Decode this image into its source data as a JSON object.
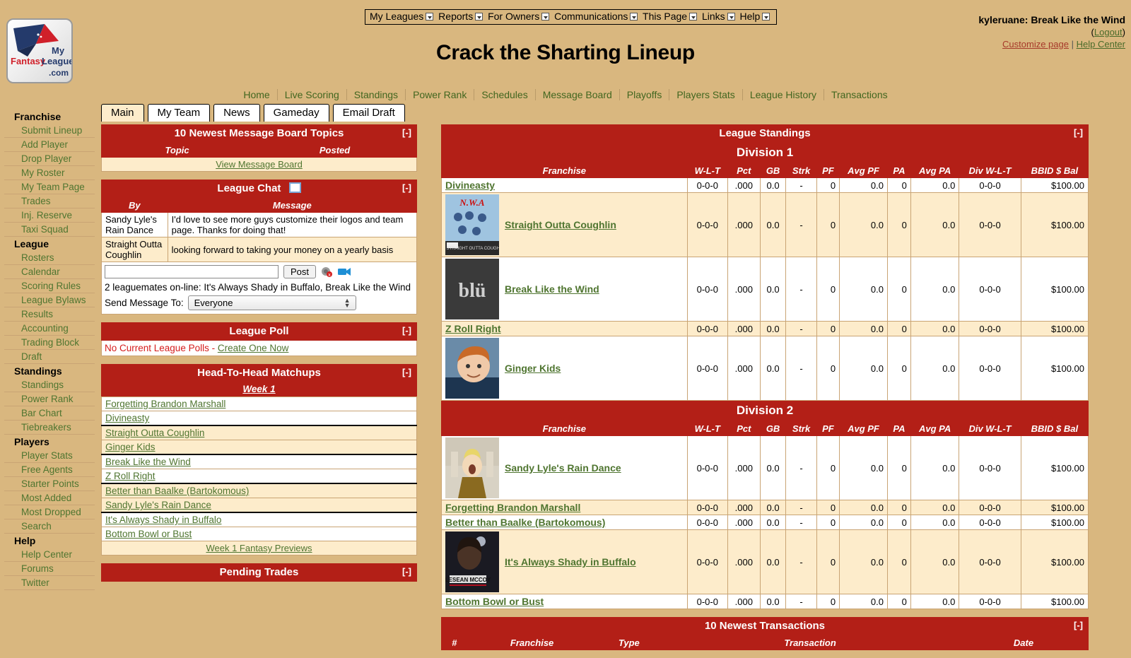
{
  "topmenu": {
    "items": [
      "My Leagues",
      "Reports",
      "For Owners",
      "Communications",
      "This Page",
      "Links",
      "Help"
    ]
  },
  "user": {
    "name": "kyleruane: Break Like the Wind",
    "logout": "Logout",
    "customize": "Customize page",
    "help_center": "Help Center",
    "separator": "|",
    "open_paren": "(",
    "close_paren": ")"
  },
  "page": {
    "title": "Crack the Sharting Lineup"
  },
  "logo": {
    "my": "My",
    "fantasy": "Fantasy",
    "league": "League",
    "com": ".com"
  },
  "mainnav": {
    "items": [
      "Home",
      "Live Scoring",
      "Standings",
      "Power Rank",
      "Schedules",
      "Message Board",
      "Playoffs",
      "Players Stats",
      "League History",
      "Transactions"
    ]
  },
  "tabs": [
    {
      "label": "Main",
      "active": true
    },
    {
      "label": "My Team",
      "active": false
    },
    {
      "label": "News",
      "active": false
    },
    {
      "label": "Gameday",
      "active": false
    },
    {
      "label": "Email Draft",
      "active": false
    }
  ],
  "sidebar": {
    "sections": [
      {
        "heading": "Franchise",
        "items": [
          "Submit Lineup",
          "Add Player",
          "Drop Player",
          "My Roster",
          "My Team Page",
          "Trades",
          "Inj. Reserve",
          "Taxi Squad"
        ]
      },
      {
        "heading": "League",
        "items": [
          "Rosters",
          "Calendar",
          "Scoring Rules",
          "League Bylaws",
          "Results",
          "Accounting",
          "Trading Block",
          "Draft"
        ]
      },
      {
        "heading": "Standings",
        "items": [
          "Standings",
          "Power Rank",
          "Bar Chart",
          "Tiebreakers"
        ]
      },
      {
        "heading": "Players",
        "items": [
          "Player Stats",
          "Free Agents",
          "Starter Points",
          "Most Added",
          "Most Dropped",
          "Search"
        ]
      },
      {
        "heading": "Help",
        "items": [
          "Help Center",
          "Forums",
          "Twitter"
        ]
      }
    ]
  },
  "message_board": {
    "title": "10 Newest Message Board Topics",
    "collapse": "[-]",
    "columns": [
      "Topic",
      "Posted"
    ],
    "view_link": "View Message Board"
  },
  "league_chat": {
    "title": "League Chat",
    "collapse": "[-]",
    "columns": [
      "By",
      "Message"
    ],
    "messages": [
      {
        "by": "Sandy Lyle's Rain Dance",
        "message": "I'd love to see more guys customize their logos and team page. Thanks for doing that!"
      },
      {
        "by": "Straight Outta Coughlin",
        "message": "looking forward to taking your money on a yearly basis"
      }
    ],
    "input_value": "",
    "input_placeholder": "",
    "post_label": "Post",
    "online_note": "2 leaguemates on-line: It's Always Shady in Buffalo, Break Like the Wind",
    "send_to_label": "Send Message To:",
    "send_to_value": "Everyone"
  },
  "league_poll": {
    "title": "League Poll",
    "collapse": "[-]",
    "no_polls_text": "No Current League Polls - ",
    "create_link": "Create One Now"
  },
  "h2h": {
    "title": "Head-To-Head Matchups",
    "collapse": "[-]",
    "week_label": "Week 1",
    "matchups": [
      [
        "Forgetting Brandon Marshall",
        "Divineasty"
      ],
      [
        "Straight Outta Coughlin",
        "Ginger Kids"
      ],
      [
        "Break Like the Wind",
        "Z Roll Right"
      ],
      [
        "Better than Baalke (Bartokomous)",
        "Sandy Lyle's Rain Dance"
      ],
      [
        "It's Always Shady in Buffalo",
        "Bottom Bowl or Bust"
      ]
    ],
    "previews_link": "Week 1 Fantasy Previews"
  },
  "pending_trades": {
    "title": "Pending Trades",
    "collapse": "[-]"
  },
  "standings": {
    "title": "League Standings",
    "collapse": "[-]",
    "columns": [
      "Franchise",
      "W-L-T",
      "Pct",
      "GB",
      "Strk",
      "PF",
      "Avg PF",
      "PA",
      "Avg PA",
      "Div W-L-T",
      "BBID $ Bal"
    ],
    "divisions": [
      {
        "name": "Division 1",
        "rows": [
          {
            "franchise": "Divineasty",
            "has_logo": false,
            "logo": "",
            "wlt": "0-0-0",
            "pct": ".000",
            "gb": "0.0",
            "strk": "-",
            "pf": "0",
            "avgpf": "0.0",
            "pa": "0",
            "avgpa": "0.0",
            "divwlt": "0-0-0",
            "bbid": "$100.00"
          },
          {
            "franchise": "Straight Outta Coughlin",
            "has_logo": true,
            "logo": "nwa",
            "wlt": "0-0-0",
            "pct": ".000",
            "gb": "0.0",
            "strk": "-",
            "pf": "0",
            "avgpf": "0.0",
            "pa": "0",
            "avgpa": "0.0",
            "divwlt": "0-0-0",
            "bbid": "$100.00"
          },
          {
            "franchise": "Break Like the Wind",
            "has_logo": true,
            "logo": "blu",
            "wlt": "0-0-0",
            "pct": ".000",
            "gb": "0.0",
            "strk": "-",
            "pf": "0",
            "avgpf": "0.0",
            "pa": "0",
            "avgpa": "0.0",
            "divwlt": "0-0-0",
            "bbid": "$100.00"
          },
          {
            "franchise": "Z Roll Right",
            "has_logo": false,
            "logo": "",
            "wlt": "0-0-0",
            "pct": ".000",
            "gb": "0.0",
            "strk": "-",
            "pf": "0",
            "avgpf": "0.0",
            "pa": "0",
            "avgpa": "0.0",
            "divwlt": "0-0-0",
            "bbid": "$100.00"
          },
          {
            "franchise": "Ginger Kids",
            "has_logo": true,
            "logo": "ginger",
            "wlt": "0-0-0",
            "pct": ".000",
            "gb": "0.0",
            "strk": "-",
            "pf": "0",
            "avgpf": "0.0",
            "pa": "0",
            "avgpa": "0.0",
            "divwlt": "0-0-0",
            "bbid": "$100.00"
          }
        ]
      },
      {
        "name": "Division 2",
        "rows": [
          {
            "franchise": "Sandy Lyle's Rain Dance",
            "has_logo": true,
            "logo": "sandy",
            "wlt": "0-0-0",
            "pct": ".000",
            "gb": "0.0",
            "strk": "-",
            "pf": "0",
            "avgpf": "0.0",
            "pa": "0",
            "avgpa": "0.0",
            "divwlt": "0-0-0",
            "bbid": "$100.00"
          },
          {
            "franchise": "Forgetting Brandon Marshall",
            "has_logo": false,
            "logo": "",
            "wlt": "0-0-0",
            "pct": ".000",
            "gb": "0.0",
            "strk": "-",
            "pf": "0",
            "avgpf": "0.0",
            "pa": "0",
            "avgpa": "0.0",
            "divwlt": "0-0-0",
            "bbid": "$100.00"
          },
          {
            "franchise": "Better than Baalke (Bartokomous)",
            "has_logo": false,
            "logo": "",
            "wlt": "0-0-0",
            "pct": ".000",
            "gb": "0.0",
            "strk": "-",
            "pf": "0",
            "avgpf": "0.0",
            "pa": "0",
            "avgpa": "0.0",
            "divwlt": "0-0-0",
            "bbid": "$100.00"
          },
          {
            "franchise": "It's Always Shady in Buffalo",
            "has_logo": true,
            "logo": "mccoy",
            "wlt": "0-0-0",
            "pct": ".000",
            "gb": "0.0",
            "strk": "-",
            "pf": "0",
            "avgpf": "0.0",
            "pa": "0",
            "avgpa": "0.0",
            "divwlt": "0-0-0",
            "bbid": "$100.00"
          },
          {
            "franchise": "Bottom Bowl or Bust",
            "has_logo": false,
            "logo": "",
            "wlt": "0-0-0",
            "pct": ".000",
            "gb": "0.0",
            "strk": "-",
            "pf": "0",
            "avgpf": "0.0",
            "pa": "0",
            "avgpa": "0.0",
            "divwlt": "0-0-0",
            "bbid": "$100.00"
          }
        ]
      }
    ]
  },
  "transactions": {
    "title": "10 Newest Transactions",
    "collapse": "[-]",
    "columns": [
      "#",
      "Franchise",
      "Type",
      "Transaction",
      "Date"
    ]
  },
  "colors": {
    "page_bg": "#d9b77f",
    "header_red": "#b31f17",
    "row_alt": "#fdeccb",
    "link_green": "#4f7530",
    "link_red": "#a63a2a"
  }
}
